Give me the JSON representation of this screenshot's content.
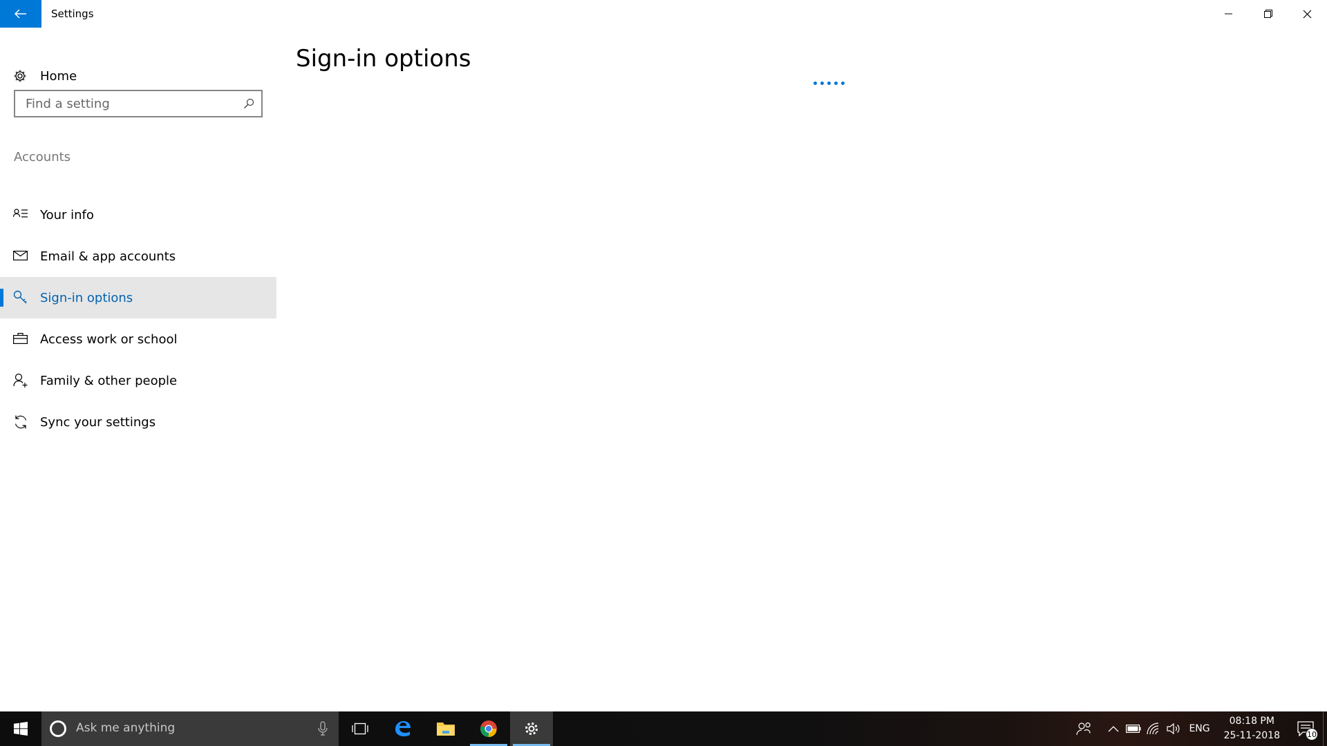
{
  "window": {
    "title": "Settings",
    "controls": {
      "minimize": "minimize-icon",
      "maximize": "restore-icon",
      "close": "close-icon"
    }
  },
  "sidebar": {
    "home_label": "Home",
    "search": {
      "placeholder": "Find a setting",
      "value": ""
    },
    "section_label": "Accounts",
    "items": [
      {
        "label": "Your info",
        "icon": "contact-card-icon",
        "active": false
      },
      {
        "label": "Email & app accounts",
        "icon": "mail-icon",
        "active": false
      },
      {
        "label": "Sign-in options",
        "icon": "key-icon",
        "active": true
      },
      {
        "label": "Access work or school",
        "icon": "briefcase-icon",
        "active": false
      },
      {
        "label": "Family & other people",
        "icon": "add-person-icon",
        "active": false
      },
      {
        "label": "Sync your settings",
        "icon": "sync-icon",
        "active": false
      }
    ]
  },
  "main": {
    "title": "Sign-in options",
    "loading": true
  },
  "taskbar": {
    "search_placeholder": "Ask me anything",
    "pinned": [
      {
        "name": "task-view",
        "icon": "task-view-icon"
      },
      {
        "name": "edge",
        "icon": "edge-icon"
      },
      {
        "name": "file-explorer",
        "icon": "folder-icon"
      },
      {
        "name": "chrome",
        "icon": "chrome-icon"
      },
      {
        "name": "settings",
        "icon": "gear-icon"
      }
    ],
    "tray": {
      "language": "ENG",
      "time": "08:18 PM",
      "date": "25-11-2018",
      "notification_count": "10"
    }
  },
  "colors": {
    "accent": "#0078d7",
    "active_text": "#0063b1",
    "active_bg": "#e6e6e6",
    "taskbar": "#101010"
  }
}
